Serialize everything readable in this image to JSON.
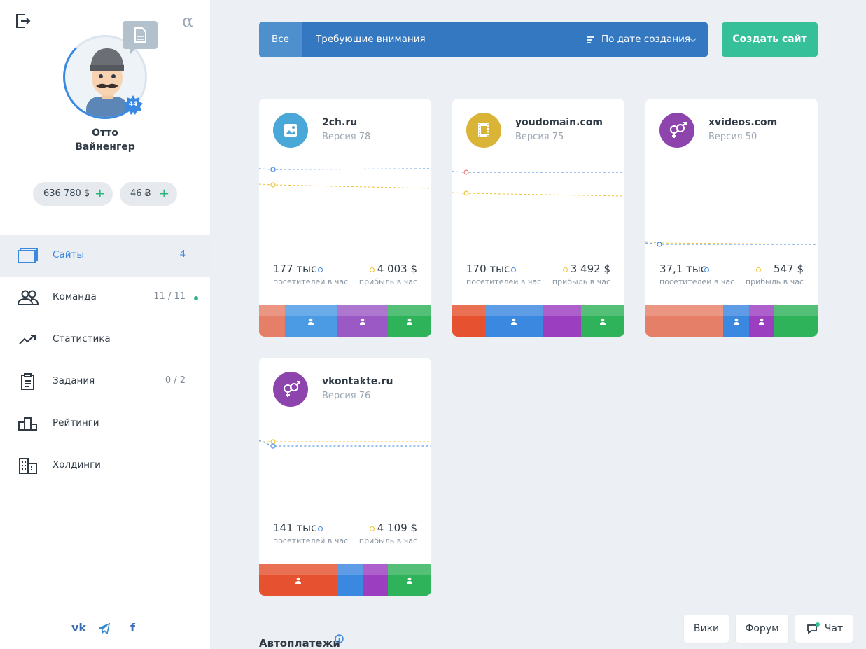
{
  "user": {
    "name_line1": "Отто",
    "name_line2": "Вайненгер",
    "level": "44",
    "balance_usd": "636 780 $",
    "balance_btc": "46 Ƀ"
  },
  "nav": [
    {
      "label": "Сайты",
      "count": "4",
      "icon": "monitor-icon",
      "active": true
    },
    {
      "label": "Команда",
      "count": "11 / 11",
      "icon": "team-icon",
      "online_dot": true
    },
    {
      "label": "Статистика",
      "count": "",
      "icon": "trend-icon"
    },
    {
      "label": "Задания",
      "count": "0 / 2",
      "icon": "clipboard-icon"
    },
    {
      "label": "Рейтинги",
      "count": "",
      "icon": "podium-icon"
    },
    {
      "label": "Холдинги",
      "count": "",
      "icon": "buildings-icon"
    }
  ],
  "social": [
    "vk-icon",
    "telegram-icon",
    "facebook-icon"
  ],
  "filters": {
    "all_label": "Все",
    "attention_label": "Требующие внимания",
    "sort_label": "По дате создания"
  },
  "create_button": "Создать сайт",
  "sites": [
    {
      "domain": "2ch.ru",
      "version": "Версия 78",
      "icon": "image-icon",
      "icon_color": "#4aa8d8",
      "visitors": "177 тыс",
      "visitors_label": "посетителей в час",
      "profit": "4 003 $",
      "profit_label": "прибыль в час",
      "blocks": [
        "#e67f67",
        "#4a9ae4",
        "#9b59c6",
        "#2fb35a"
      ]
    },
    {
      "domain": "youdomain.com",
      "version": "Версия 75",
      "icon": "film-icon",
      "icon_color": "#d9b437",
      "visitors": "170 тыс",
      "visitors_label": "посетителей в час",
      "profit": "3 492 $",
      "profit_label": "прибыль в час",
      "blocks": [
        "#e6512f",
        "#3b88e0",
        "#9b3ec0",
        "#2fb35a"
      ]
    },
    {
      "domain": "xvideos.com",
      "version": "Версия 50",
      "icon": "gender-icon",
      "icon_color": "#8e44ad",
      "visitors": "37,1 тыс",
      "visitors_label": "посетителей в час",
      "profit": "547 $",
      "profit_label": "прибыль в час",
      "blocks": [
        "#e67f67",
        "#3b88e0",
        "#9b3ec0",
        "#2fb35a"
      ]
    },
    {
      "domain": "vkontakte.ru",
      "version": "Версия 76",
      "icon": "gender-icon",
      "icon_color": "#8e44ad",
      "visitors": "141 тыс",
      "visitors_label": "посетителей в час",
      "profit": "4 109 $",
      "profit_label": "прибыль в час",
      "blocks": [
        "#e6512f",
        "#3b88e0",
        "#9b3ec0",
        "#2fb35a"
      ]
    }
  ],
  "autopay_label": "Автоплатежи",
  "footer": {
    "wiki": "Вики",
    "forum": "Форум",
    "chat": "Чат"
  }
}
